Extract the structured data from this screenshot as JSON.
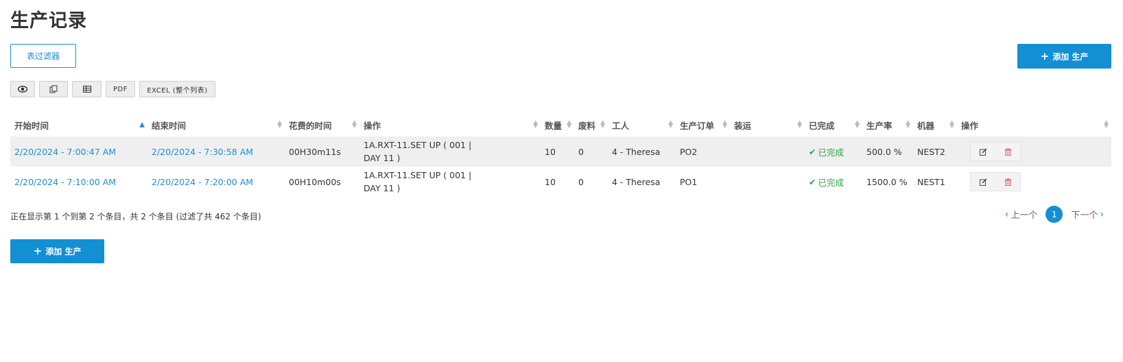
{
  "page": {
    "title": "生产记录"
  },
  "toolbar": {
    "filter_label": "表过滤器",
    "add_label": "添加 生产",
    "pdf_label": "PDF",
    "excel_label": "EXCEL (整个列表)",
    "icons": [
      "eye-icon",
      "copy-icon",
      "columns-icon"
    ]
  },
  "table": {
    "headers": [
      "开始时间",
      "结束时间",
      "花费的时间",
      "操作",
      "数量",
      "废料",
      "工人",
      "生产订单",
      "装运",
      "已完成",
      "生产率",
      "机器",
      "操作"
    ],
    "sorted_column": "开始时间",
    "rows": [
      {
        "start": "2/20/2024 - 7:00:47 AM",
        "end": "2/20/2024 - 7:30:58 AM",
        "duration": "00H30m11s",
        "operation_line1": "1A.RXT-11.SET UP ( 001 |",
        "operation_line2": "DAY 11 )",
        "quantity": "10",
        "scrap": "0",
        "worker": "4 - Theresa",
        "order": "PO2",
        "shipment": "",
        "completed": "已完成",
        "rate": "500.0 %",
        "machine": "NEST2"
      },
      {
        "start": "2/20/2024 - 7:10:00 AM",
        "end": "2/20/2024 - 7:20:00 AM",
        "duration": "00H10m00s",
        "operation_line1": "1A.RXT-11.SET UP ( 001 |",
        "operation_line2": "DAY 11 )",
        "quantity": "10",
        "scrap": "0",
        "worker": "4 - Theresa",
        "order": "PO1",
        "shipment": "",
        "completed": "已完成",
        "rate": "1500.0 %",
        "machine": "NEST1"
      }
    ]
  },
  "footer": {
    "info": "正在显示第 1 个到第 2 个条目，共 2 个条目 (过滤了共 462 个条目)",
    "prev_label": "上一个",
    "next_label": "下一个",
    "current_page": "1"
  },
  "colors": {
    "accent": "#138fd4",
    "success": "#2aa54a",
    "danger": "#e0505a",
    "row_stripe": "#efefef"
  }
}
